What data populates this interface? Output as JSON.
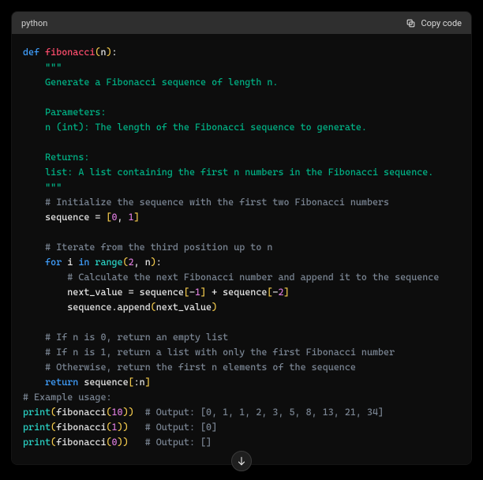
{
  "header": {
    "language": "python",
    "copy": "Copy code"
  },
  "code": {
    "lines": [
      {
        "indent": 0,
        "spans": [
          {
            "cls": "tok-kw",
            "t": "def"
          },
          {
            "cls": "",
            "t": " "
          },
          {
            "cls": "tok-fn",
            "t": "fibonacci"
          },
          {
            "cls": "tok-paren",
            "t": "("
          },
          {
            "cls": "tok-var",
            "t": "n"
          },
          {
            "cls": "tok-paren",
            "t": ")"
          },
          {
            "cls": "",
            "t": ":"
          }
        ]
      },
      {
        "indent": 1,
        "spans": [
          {
            "cls": "tok-str",
            "t": "\"\"\""
          }
        ]
      },
      {
        "indent": 1,
        "spans": [
          {
            "cls": "tok-str",
            "t": "Generate a Fibonacci sequence of length n."
          }
        ]
      },
      {
        "indent": 1,
        "spans": [
          {
            "cls": "",
            "t": ""
          }
        ]
      },
      {
        "indent": 1,
        "spans": [
          {
            "cls": "tok-str",
            "t": "Parameters:"
          }
        ]
      },
      {
        "indent": 1,
        "spans": [
          {
            "cls": "tok-str",
            "t": "n (int): The length of the Fibonacci sequence to generate."
          }
        ]
      },
      {
        "indent": 1,
        "spans": [
          {
            "cls": "",
            "t": ""
          }
        ]
      },
      {
        "indent": 1,
        "spans": [
          {
            "cls": "tok-str",
            "t": "Returns:"
          }
        ]
      },
      {
        "indent": 1,
        "spans": [
          {
            "cls": "tok-str",
            "t": "list: A list containing the first n numbers in the Fibonacci sequence."
          }
        ]
      },
      {
        "indent": 1,
        "spans": [
          {
            "cls": "tok-str",
            "t": "\"\"\""
          }
        ]
      },
      {
        "indent": 1,
        "spans": [
          {
            "cls": "tok-com",
            "t": "# Initialize the sequence with the first two Fibonacci numbers"
          }
        ]
      },
      {
        "indent": 1,
        "spans": [
          {
            "cls": "tok-var",
            "t": "sequence = "
          },
          {
            "cls": "tok-br",
            "t": "["
          },
          {
            "cls": "tok-num",
            "t": "0"
          },
          {
            "cls": "tok-var",
            "t": ", "
          },
          {
            "cls": "tok-num",
            "t": "1"
          },
          {
            "cls": "tok-br",
            "t": "]"
          }
        ]
      },
      {
        "indent": 1,
        "spans": [
          {
            "cls": "",
            "t": ""
          }
        ]
      },
      {
        "indent": 1,
        "spans": [
          {
            "cls": "tok-com",
            "t": "# Iterate from the third position up to n"
          }
        ]
      },
      {
        "indent": 1,
        "spans": [
          {
            "cls": "tok-kw",
            "t": "for"
          },
          {
            "cls": "",
            "t": " "
          },
          {
            "cls": "tok-var",
            "t": "i"
          },
          {
            "cls": "",
            "t": " "
          },
          {
            "cls": "tok-kw",
            "t": "in"
          },
          {
            "cls": "",
            "t": " "
          },
          {
            "cls": "tok-cfn",
            "t": "range"
          },
          {
            "cls": "tok-paren",
            "t": "("
          },
          {
            "cls": "tok-num",
            "t": "2"
          },
          {
            "cls": "tok-var",
            "t": ", n"
          },
          {
            "cls": "tok-paren",
            "t": ")"
          },
          {
            "cls": "",
            "t": ":"
          }
        ]
      },
      {
        "indent": 2,
        "spans": [
          {
            "cls": "tok-com",
            "t": "# Calculate the next Fibonacci number and append it to the sequence"
          }
        ]
      },
      {
        "indent": 2,
        "spans": [
          {
            "cls": "tok-var",
            "t": "next_value = sequence"
          },
          {
            "cls": "tok-br",
            "t": "["
          },
          {
            "cls": "tok-var",
            "t": "-"
          },
          {
            "cls": "tok-num",
            "t": "1"
          },
          {
            "cls": "tok-br",
            "t": "]"
          },
          {
            "cls": "tok-var",
            "t": " + sequence"
          },
          {
            "cls": "tok-br",
            "t": "["
          },
          {
            "cls": "tok-var",
            "t": "-"
          },
          {
            "cls": "tok-num",
            "t": "2"
          },
          {
            "cls": "tok-br",
            "t": "]"
          }
        ]
      },
      {
        "indent": 2,
        "spans": [
          {
            "cls": "tok-var",
            "t": "sequence.append"
          },
          {
            "cls": "tok-paren",
            "t": "("
          },
          {
            "cls": "tok-var",
            "t": "next_value"
          },
          {
            "cls": "tok-paren",
            "t": ")"
          }
        ]
      },
      {
        "indent": 1,
        "spans": [
          {
            "cls": "",
            "t": ""
          }
        ]
      },
      {
        "indent": 1,
        "spans": [
          {
            "cls": "tok-com",
            "t": "# If n is 0, return an empty list"
          }
        ]
      },
      {
        "indent": 1,
        "spans": [
          {
            "cls": "tok-com",
            "t": "# If n is 1, return a list with only the first Fibonacci number"
          }
        ]
      },
      {
        "indent": 1,
        "spans": [
          {
            "cls": "tok-com",
            "t": "# Otherwise, return the first n elements of the sequence"
          }
        ]
      },
      {
        "indent": 1,
        "spans": [
          {
            "cls": "tok-kw",
            "t": "return"
          },
          {
            "cls": "",
            "t": " "
          },
          {
            "cls": "tok-var",
            "t": "sequence"
          },
          {
            "cls": "tok-br",
            "t": "["
          },
          {
            "cls": "tok-var",
            "t": ":n"
          },
          {
            "cls": "tok-br",
            "t": "]"
          }
        ]
      },
      {
        "indent": 0,
        "spans": [
          {
            "cls": "",
            "t": ""
          }
        ]
      },
      {
        "indent": 0,
        "spans": [
          {
            "cls": "tok-com",
            "t": "# Example usage:"
          }
        ]
      },
      {
        "indent": 0,
        "spans": [
          {
            "cls": "tok-cfn",
            "t": "print"
          },
          {
            "cls": "tok-paren",
            "t": "("
          },
          {
            "cls": "tok-var",
            "t": "fibonacci"
          },
          {
            "cls": "tok-paren",
            "t": "("
          },
          {
            "cls": "tok-num",
            "t": "10"
          },
          {
            "cls": "tok-paren",
            "t": "))"
          },
          {
            "cls": "",
            "t": "  "
          },
          {
            "cls": "tok-com",
            "t": "# Output: [0, 1, 1, 2, 3, 5, 8, 13, 21, 34]"
          }
        ]
      },
      {
        "indent": 0,
        "spans": [
          {
            "cls": "tok-cfn",
            "t": "print"
          },
          {
            "cls": "tok-paren",
            "t": "("
          },
          {
            "cls": "tok-var",
            "t": "fibonacci"
          },
          {
            "cls": "tok-paren",
            "t": "("
          },
          {
            "cls": "tok-num",
            "t": "1"
          },
          {
            "cls": "tok-paren",
            "t": "))"
          },
          {
            "cls": "",
            "t": "   "
          },
          {
            "cls": "tok-com",
            "t": "# Output: [0]"
          }
        ]
      },
      {
        "indent": 0,
        "spans": [
          {
            "cls": "tok-cfn",
            "t": "print"
          },
          {
            "cls": "tok-paren",
            "t": "("
          },
          {
            "cls": "tok-var",
            "t": "fibonacci"
          },
          {
            "cls": "tok-paren",
            "t": "("
          },
          {
            "cls": "tok-num",
            "t": "0"
          },
          {
            "cls": "tok-paren",
            "t": "))"
          },
          {
            "cls": "",
            "t": "   "
          },
          {
            "cls": "tok-com",
            "t": "# Output: []"
          }
        ]
      }
    ]
  }
}
